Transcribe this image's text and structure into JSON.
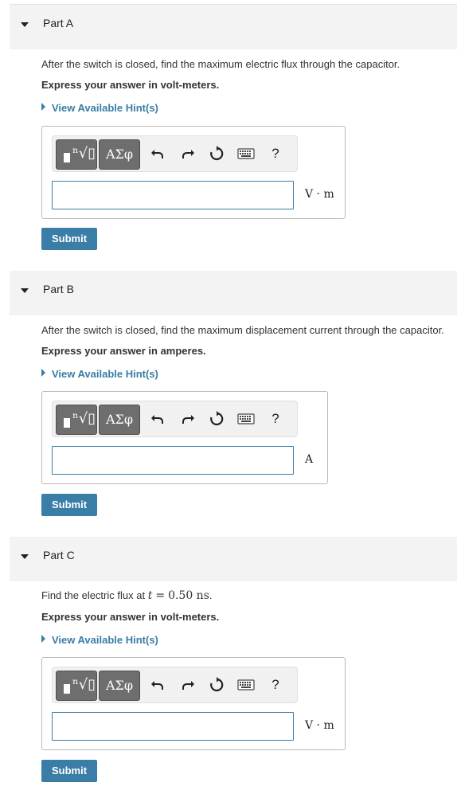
{
  "parts": [
    {
      "title": "Part A",
      "question": "After the switch is closed, find the maximum electric flux through the capacitor.",
      "instruction": "Express your answer in volt-meters.",
      "hint": "View Available Hint(s)",
      "input_value": "",
      "unit": "V · m",
      "submit": "Submit"
    },
    {
      "title": "Part B",
      "question": "After the switch is closed, find the maximum displacement current through the capacitor.",
      "instruction": "Express your answer in amperes.",
      "hint": "View Available Hint(s)",
      "input_value": "",
      "unit": "A",
      "submit": "Submit"
    },
    {
      "title": "Part C",
      "question_prefix": "Find the electric flux at",
      "question_var": "t",
      "question_op": "=",
      "question_value": "0.50 ns",
      "question_suffix": ".",
      "instruction": "Express your answer in volt-meters.",
      "hint": "View Available Hint(s)",
      "input_value": "",
      "unit": "V · m",
      "submit": "Submit"
    }
  ],
  "toolbar": {
    "templates_symbol": "ⁿ√▯",
    "greek": "ΑΣφ",
    "undo_icon": "undo-icon",
    "redo_icon": "redo-icon",
    "reset_icon": "reset-icon",
    "keyboard_icon": "keyboard-icon",
    "help": "?"
  }
}
